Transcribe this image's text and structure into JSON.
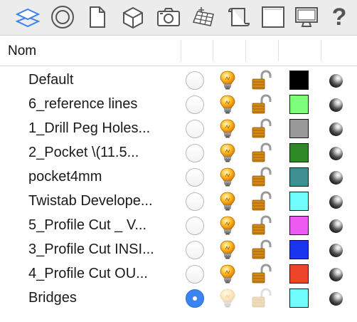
{
  "toolbar": {
    "icons": [
      "layers-icon",
      "circle-target-icon",
      "document-icon",
      "cube-icon",
      "camera-icon",
      "grid-icon",
      "scroll-icon",
      "frame-icon",
      "monitor-icon",
      "help-icon"
    ],
    "help_label": "?"
  },
  "table": {
    "column_name_header": "Nom",
    "layers": [
      {
        "name": "Default",
        "color": "#000000",
        "active": false
      },
      {
        "name": "6_reference lines",
        "color": "#7dff7a",
        "active": false
      },
      {
        "name": "1_Drill Peg Holes...",
        "color": "#999999",
        "active": false
      },
      {
        "name": "2_Pocket \\(11.5...",
        "color": "#2e8a24",
        "active": false
      },
      {
        "name": "pocket4mm",
        "color": "#3f9092",
        "active": false
      },
      {
        "name": "Twistab Develope...",
        "color": "#6ffdfd",
        "active": false
      },
      {
        "name": "5_Profile Cut _ V...",
        "color": "#ee5bf3",
        "active": false
      },
      {
        "name": "3_Profile Cut INSI...",
        "color": "#1a35f0",
        "active": false
      },
      {
        "name": "4_Profile Cut OU...",
        "color": "#ee442a",
        "active": false
      },
      {
        "name": "Bridges",
        "color": "#6ffdfd",
        "active": true
      }
    ]
  }
}
